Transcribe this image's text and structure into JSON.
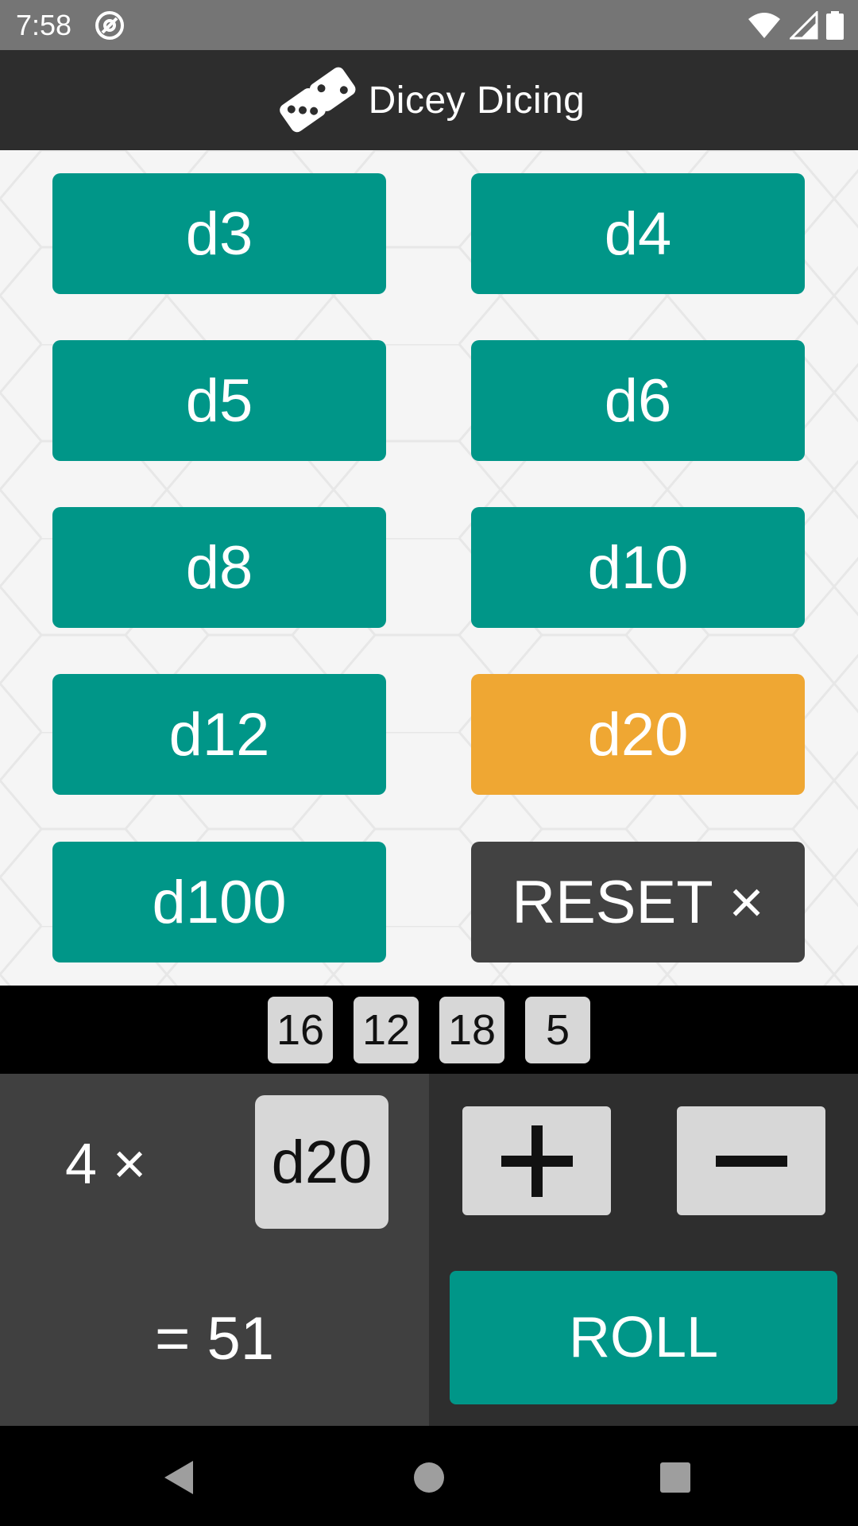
{
  "status_bar": {
    "time": "7:58",
    "icons": [
      "at-sign-icon",
      "wifi-icon",
      "signal-icon",
      "battery-icon"
    ]
  },
  "app_bar": {
    "title": "Dicey Dicing",
    "logo_icon": "dice-logo-icon"
  },
  "dice_buttons": [
    {
      "label": "d3"
    },
    {
      "label": "d4"
    },
    {
      "label": "d5"
    },
    {
      "label": "d6"
    },
    {
      "label": "d8"
    },
    {
      "label": "d10"
    },
    {
      "label": "d12"
    },
    {
      "label": "d20",
      "selected": true
    },
    {
      "label": "d100"
    }
  ],
  "reset_button": {
    "label": "RESET ×"
  },
  "results": [
    "16",
    "12",
    "18",
    "5"
  ],
  "controls": {
    "count_label": "4 ×",
    "selected_die": "d20",
    "plus_icon": "plus-icon",
    "minus_icon": "minus-icon",
    "total_label": "= 51",
    "roll_label": "ROLL"
  },
  "nav_bar": {
    "icons": [
      "back-icon",
      "home-icon",
      "recents-icon"
    ]
  },
  "colors": {
    "accent_teal": "#009688",
    "selected_orange": "#efa733",
    "reset_dark": "#424242",
    "app_bar": "#2d2d2d"
  }
}
